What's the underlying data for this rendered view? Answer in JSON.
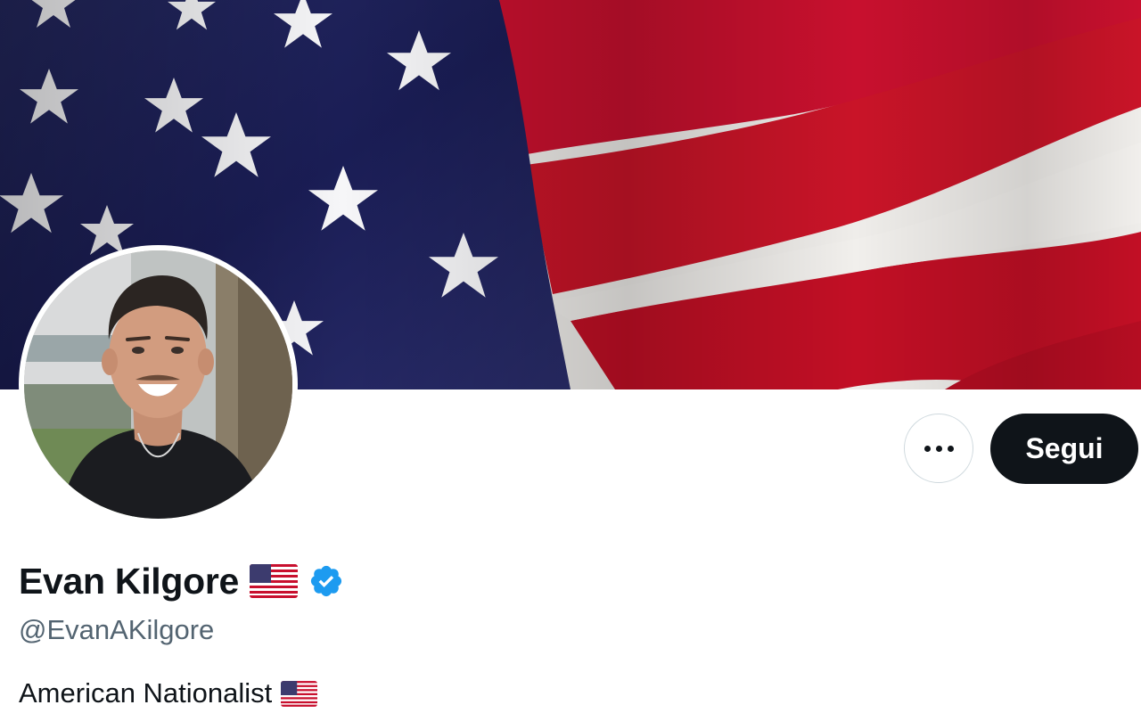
{
  "profile": {
    "display_name": "Evan Kilgore",
    "handle": "@EvanAKilgore",
    "bio": "American Nationalist",
    "name_badge_icon": "us-flag-emoji-icon",
    "verified_icon": "verified-badge-icon",
    "bio_badge_icon": "us-flag-emoji-icon"
  },
  "actions": {
    "more_icon": "more-horizontal-icon",
    "follow_label": "Segui"
  },
  "colors": {
    "verified_blue": "#1d9bf0",
    "follow_button_bg": "#0f1419",
    "handle_gray": "#536471",
    "flag_red": "#c8102e",
    "flag_blue": "#1c1f5e"
  }
}
